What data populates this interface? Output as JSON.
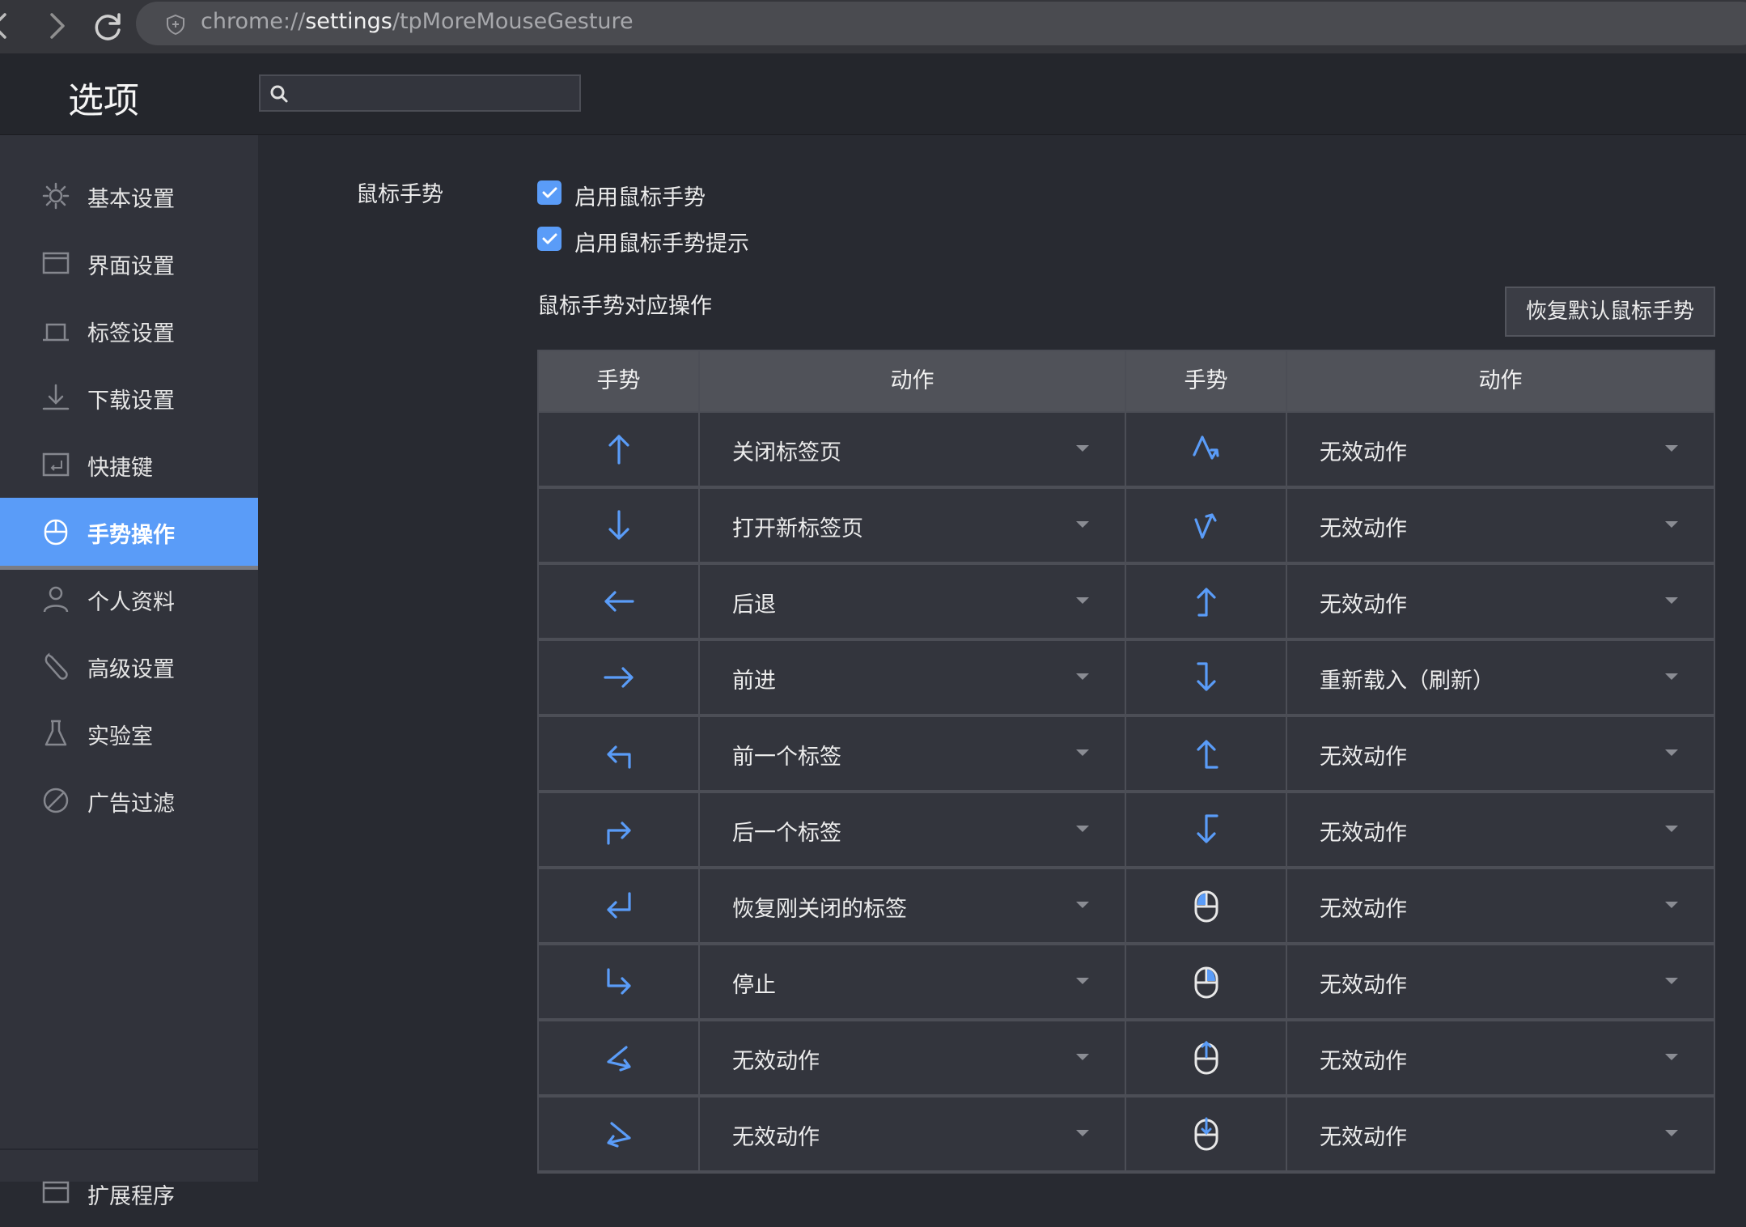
{
  "browser": {
    "url_scheme": "chrome://",
    "url_host": "settings",
    "url_path": "/tpMoreMouseGesture"
  },
  "header": {
    "title": "选项",
    "search_placeholder": ""
  },
  "sidebar": {
    "items": [
      {
        "label": "基本设置",
        "icon": "gear-icon"
      },
      {
        "label": "界面设置",
        "icon": "window-icon"
      },
      {
        "label": "标签设置",
        "icon": "tab-icon"
      },
      {
        "label": "下载设置",
        "icon": "download-icon"
      },
      {
        "label": "快捷键",
        "icon": "keyboard-icon"
      },
      {
        "label": "手势操作",
        "icon": "mouse-icon",
        "active": true
      },
      {
        "label": "个人资料",
        "icon": "user-icon"
      },
      {
        "label": "高级设置",
        "icon": "wrench-icon"
      },
      {
        "label": "实验室",
        "icon": "flask-icon"
      },
      {
        "label": "广告过滤",
        "icon": "block-icon"
      }
    ],
    "bottom_item": {
      "label": "扩展程序",
      "icon": "extension-icon"
    }
  },
  "content": {
    "section_label": "鼠标手势",
    "checkboxes": [
      {
        "label": "启用鼠标手势",
        "checked": true
      },
      {
        "label": "启用鼠标手势提示",
        "checked": true
      }
    ],
    "subsection_title": "鼠标手势对应操作",
    "reset_button": "恢复默认鼠标手势",
    "table_headers": [
      "手势",
      "动作",
      "手势",
      "动作"
    ],
    "rows": [
      {
        "left_gesture": "up-arrow-icon",
        "left_action": "关闭标签页",
        "right_gesture": "down-up-zigzag-icon",
        "right_action": "无效动作"
      },
      {
        "left_gesture": "down-arrow-icon",
        "left_action": "打开新标签页",
        "right_gesture": "up-down-zigzag-icon",
        "right_action": "无效动作"
      },
      {
        "left_gesture": "left-arrow-icon",
        "left_action": "后退",
        "right_gesture": "down-then-up-icon",
        "right_action": "无效动作"
      },
      {
        "left_gesture": "right-arrow-icon",
        "left_action": "前进",
        "right_gesture": "up-then-down-icon",
        "right_action": "重新载入（刷新）"
      },
      {
        "left_gesture": "up-left-turn-icon",
        "left_action": "前一个标签",
        "right_gesture": "down-left-then-up-icon",
        "right_action": "无效动作"
      },
      {
        "left_gesture": "up-right-turn-icon",
        "left_action": "后一个标签",
        "right_gesture": "up-left-then-down-icon",
        "right_action": "无效动作"
      },
      {
        "left_gesture": "right-down-left-icon",
        "left_action": "恢复刚关闭的标签",
        "right_gesture": "mouse-left-click-icon",
        "right_action": "无效动作"
      },
      {
        "left_gesture": "down-then-right-icon",
        "left_action": "停止",
        "right_gesture": "mouse-right-click-icon",
        "right_action": "无效动作"
      },
      {
        "left_gesture": "right-left-zigzag-icon",
        "left_action": "无效动作",
        "right_gesture": "mouse-scroll-up-icon",
        "right_action": "无效动作"
      },
      {
        "left_gesture": "left-right-zigzag-icon",
        "left_action": "无效动作",
        "right_gesture": "mouse-scroll-down-icon",
        "right_action": "无效动作"
      }
    ]
  },
  "colors": {
    "accent": "#5a9cf8",
    "background": "#282a31",
    "sidebar": "#31333b",
    "cell": "#33353d",
    "table_header": "#505259"
  }
}
